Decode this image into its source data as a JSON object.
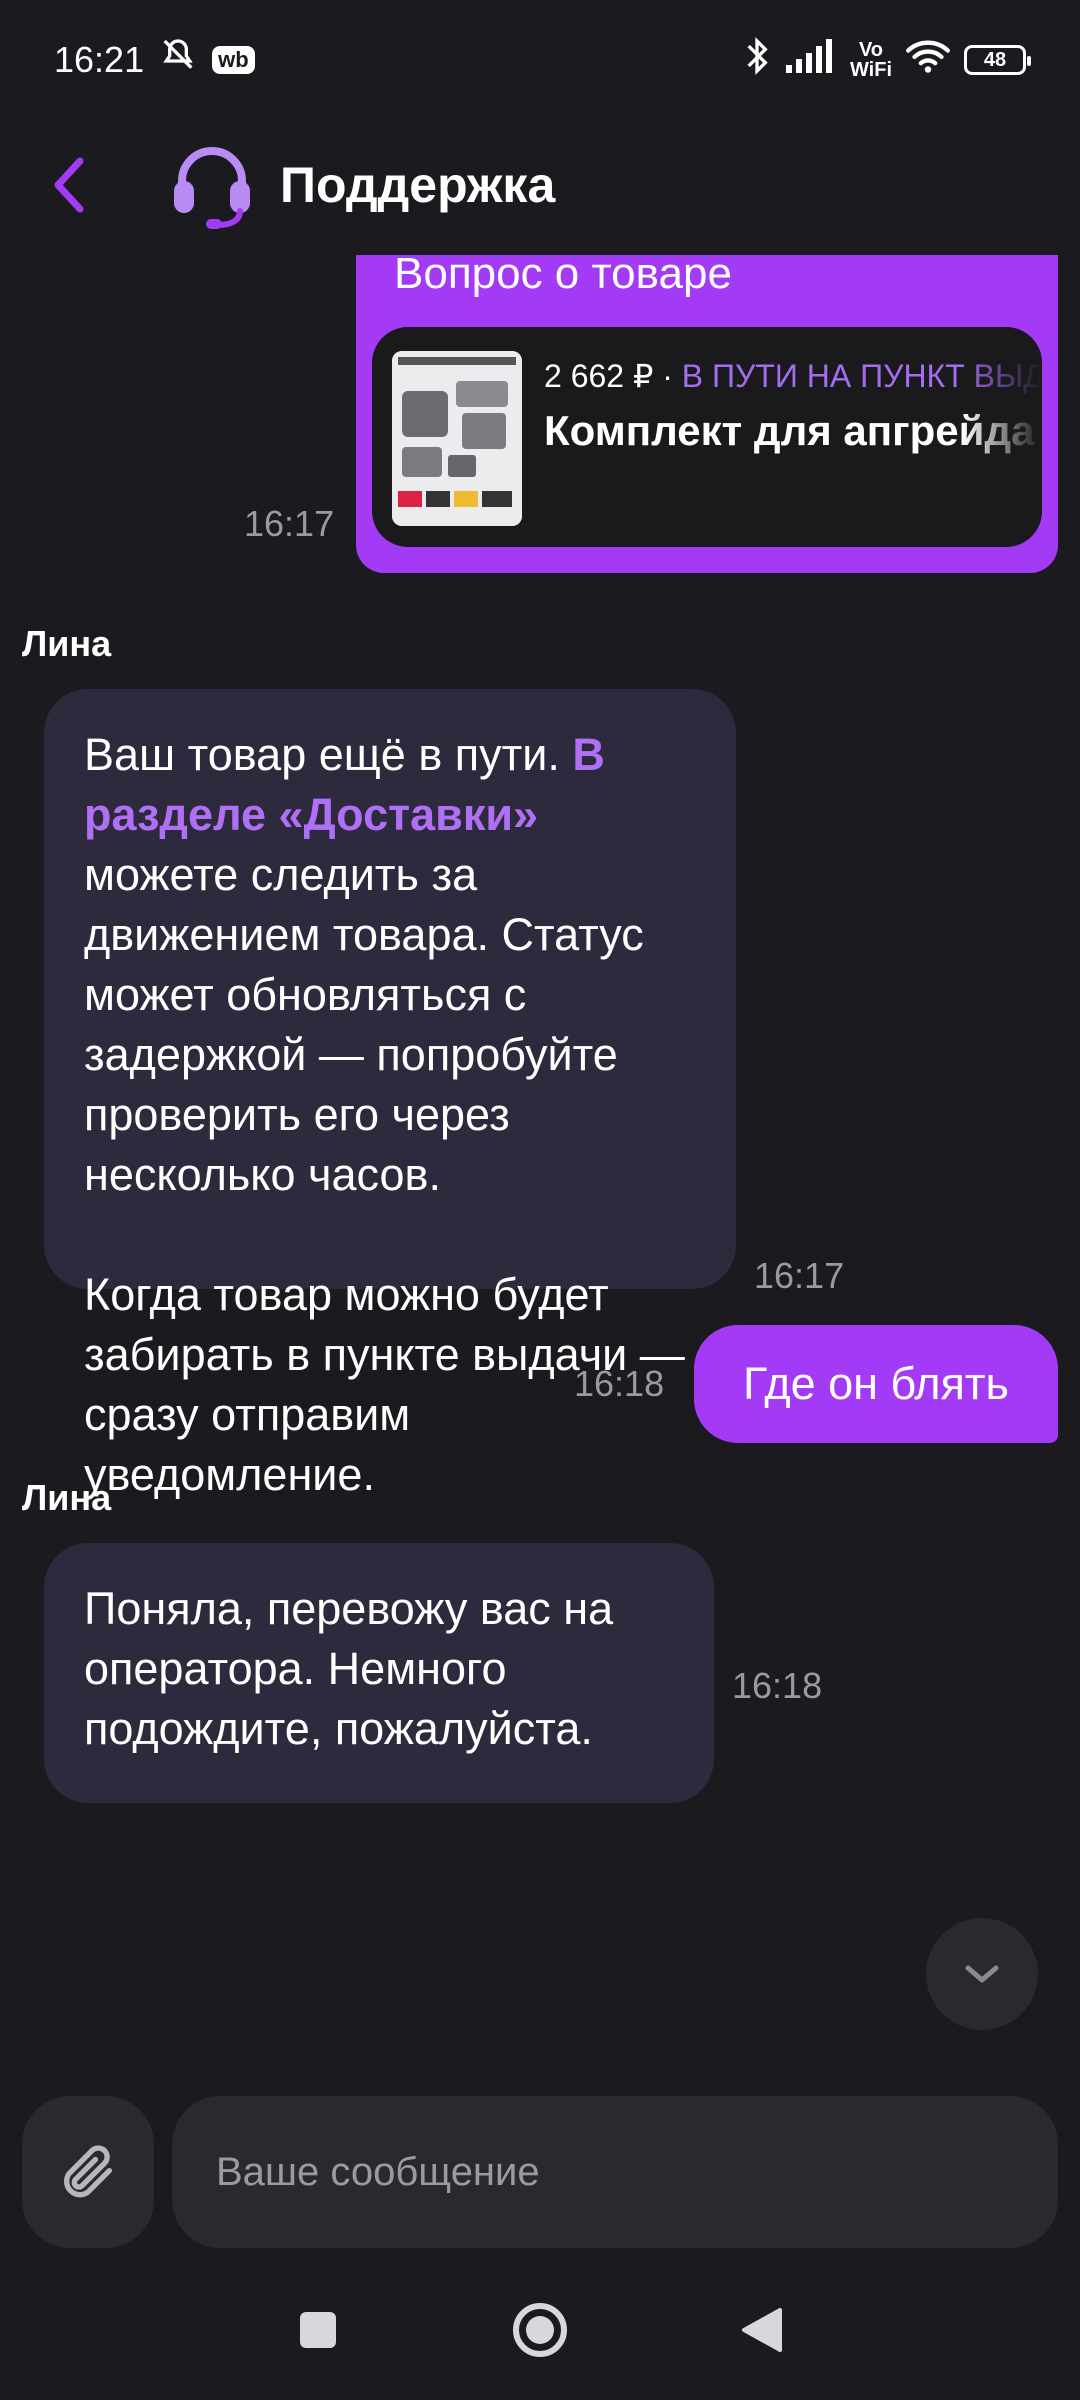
{
  "status_bar": {
    "time": "16:21",
    "app_badge": "wb",
    "network_label_top": "Vo",
    "network_label_bottom": "WiFi",
    "battery": "48"
  },
  "header": {
    "title": "Поддержка"
  },
  "messages": {
    "product_question": {
      "title": "Вопрос о товаре",
      "price": "2 662 ₽ · ",
      "status": "В ПУТИ НА ПУНКТ ВЫДАЧИ",
      "name": "Комплект для апгрейда конструкторов",
      "time": "16:17"
    },
    "reply1": {
      "sender": "Лина",
      "text_before_link": "Ваш товар ещё в пути. ",
      "link_text": "В разделе «Доставки»",
      "text_after_link": " можете следить за движением товара. Статус может обновляться с задержкой — попробуйте проверить его через несколько часов.",
      "text_para2": "Когда товар можно будет забирать в пункте выдачи — сразу отправим уведомление.",
      "time": "16:17"
    },
    "user_msg": {
      "text": "Где он блять",
      "time": "16:18"
    },
    "reply2": {
      "sender": "Лина",
      "text": "Поняла, перевожу вас на оператора. Немного подождите, пожалуйста.",
      "time": "16:18"
    }
  },
  "composer": {
    "placeholder": "Ваше сообщение"
  },
  "colors": {
    "accent": "#a33af5",
    "link": "#b070f5",
    "incoming_bubble": "#2e2a3d",
    "background": "#1b1a1f"
  }
}
